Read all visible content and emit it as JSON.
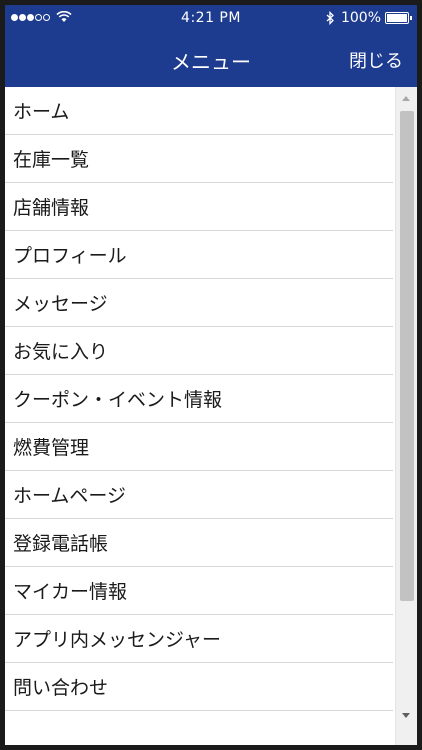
{
  "status_bar": {
    "time": "4:21 PM",
    "battery_text": "100%",
    "battery_level": 1.0,
    "signal_strength": 3,
    "signal_max": 5
  },
  "nav": {
    "title": "メニュー",
    "close_label": "閉じる"
  },
  "menu": {
    "items": [
      {
        "label": "ホーム"
      },
      {
        "label": "在庫一覧"
      },
      {
        "label": "店舗情報"
      },
      {
        "label": "プロフィール"
      },
      {
        "label": "メッセージ"
      },
      {
        "label": "お気に入り"
      },
      {
        "label": "クーポン・イベント情報"
      },
      {
        "label": "燃費管理"
      },
      {
        "label": "ホームページ"
      },
      {
        "label": "登録電話帳"
      },
      {
        "label": "マイカー情報"
      },
      {
        "label": "アプリ内メッセンジャー"
      },
      {
        "label": "問い合わせ"
      }
    ]
  },
  "colors": {
    "header": "#1d3b8f",
    "divider": "#d6d6d6"
  }
}
